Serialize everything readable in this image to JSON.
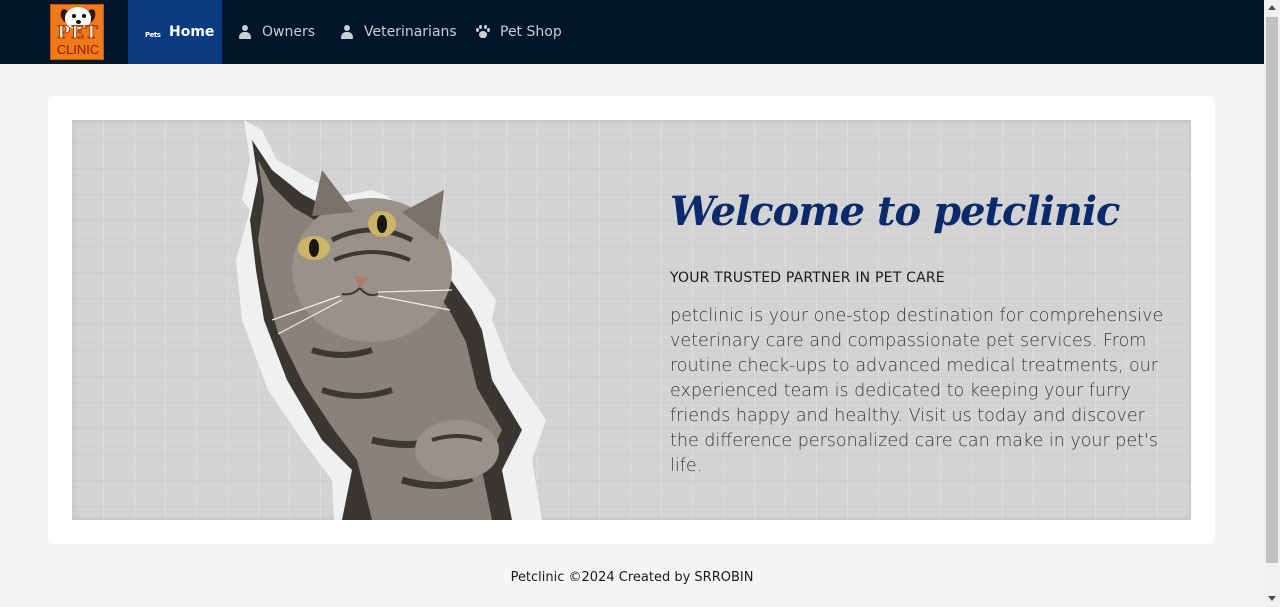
{
  "logo": {
    "line1": "PET",
    "line2": "CLINIC"
  },
  "nav": {
    "items": [
      {
        "label": "Home",
        "icon": "pets-home-icon",
        "active": true
      },
      {
        "label": "Owners",
        "icon": "owner-person-icon",
        "active": false
      },
      {
        "label": "Veterinarians",
        "icon": "veterinarian-icon",
        "active": false
      },
      {
        "label": "Pet Shop",
        "icon": "paw-icon",
        "active": false
      }
    ],
    "home_icon_text": "Pets"
  },
  "hero": {
    "title": "Welcome to petclinic",
    "subtitle": "YOUR TRUSTED PARTNER IN PET CARE",
    "description": "petclinic is your one-stop destination for comprehensive veterinary care and compassionate pet services. From routine check-ups to advanced medical treatments, our experienced team is dedicated to keeping your furry friends happy and healthy. Visit us today and discover the difference personalized care can make in your pet's life."
  },
  "footer": {
    "text": "Petclinic ©2024 Created by SRROBIN"
  },
  "colors": {
    "navbar": "#001529",
    "nav_active": "#0a3a80",
    "title": "#0a2a6b",
    "logo_bg": "#f07a1a"
  }
}
